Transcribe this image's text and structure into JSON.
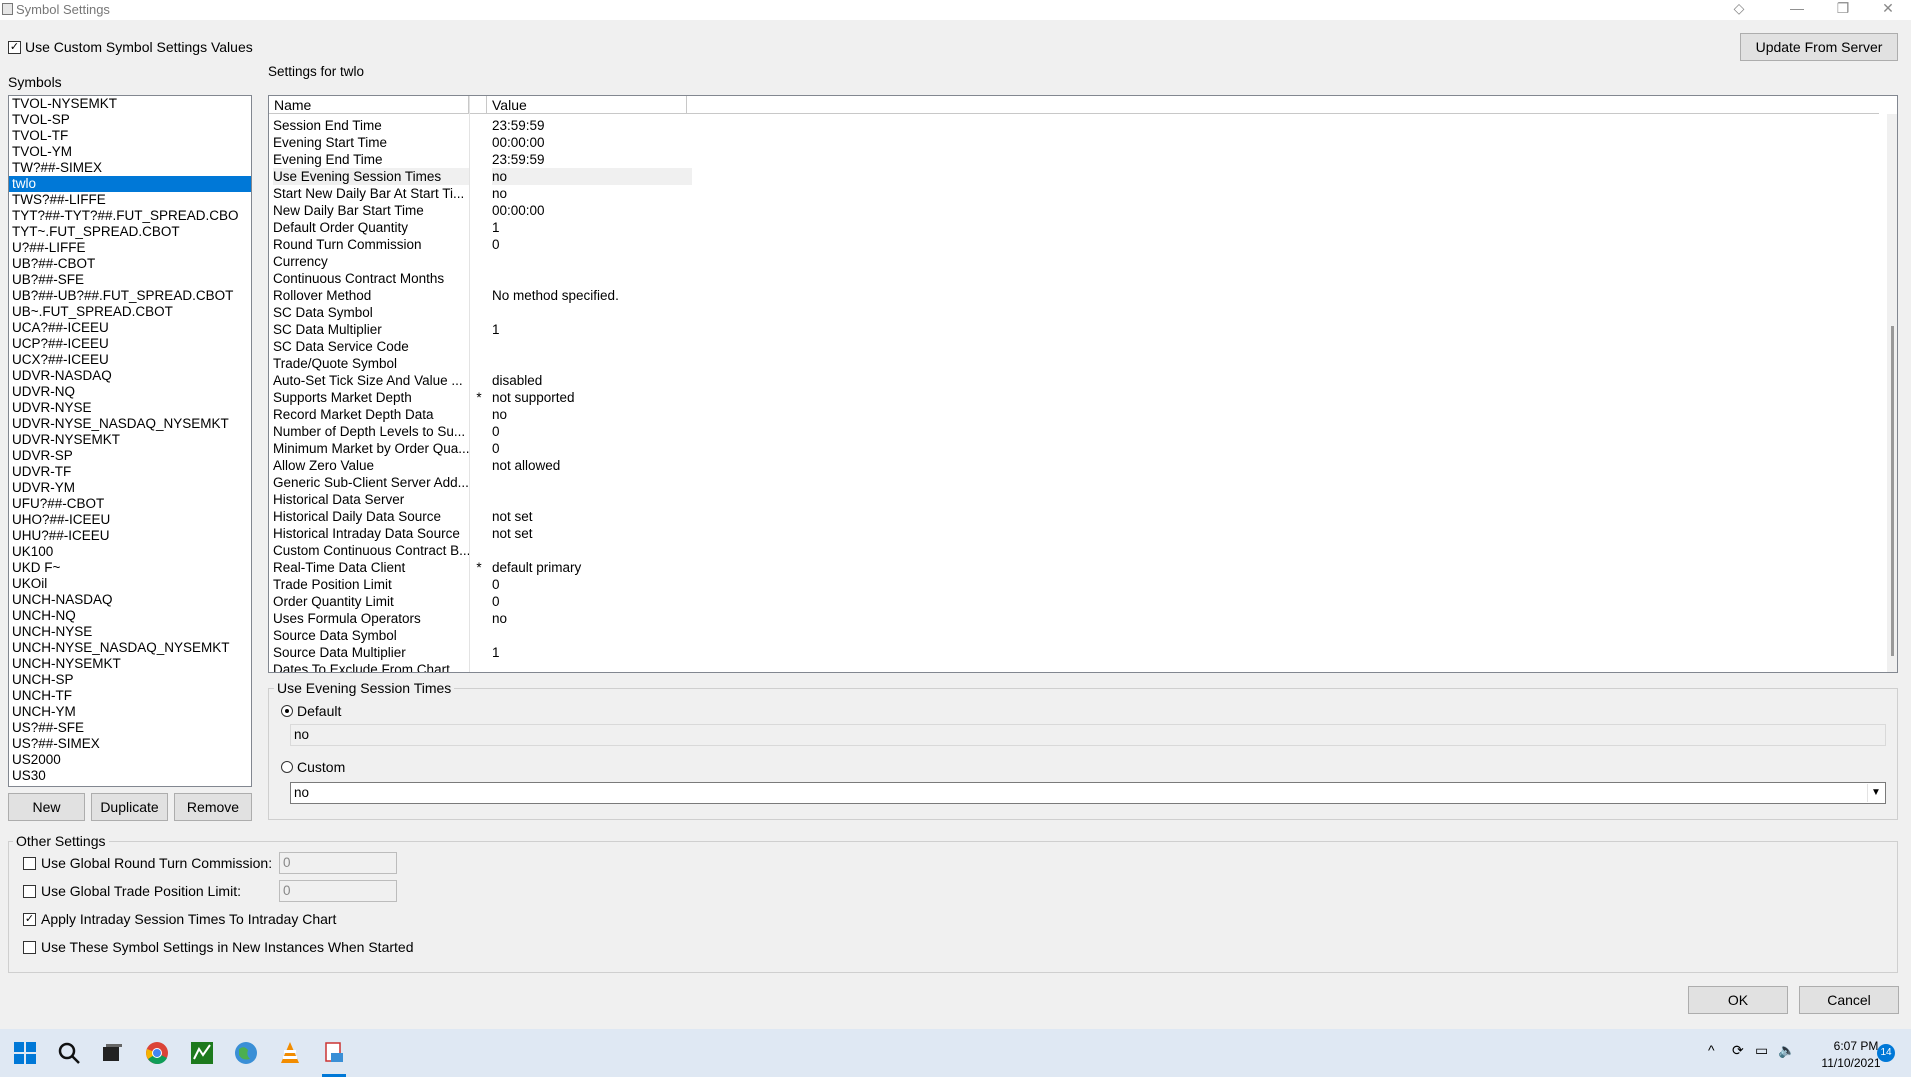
{
  "window": {
    "title": "Symbol Settings"
  },
  "top": {
    "use_custom_label": "Use Custom Symbol Settings Values",
    "update_button": "Update From Server"
  },
  "symbols": {
    "label": "Symbols",
    "items": [
      "TVOL-NYSEMKT",
      "TVOL-SP",
      "TVOL-TF",
      "TVOL-YM",
      "TW?##-SIMEX",
      "twlo",
      "TWS?##-LIFFE",
      "TYT?##-TYT?##.FUT_SPREAD.CBO",
      "TYT~.FUT_SPREAD.CBOT",
      "U?##-LIFFE",
      "UB?##-CBOT",
      "UB?##-SFE",
      "UB?##-UB?##.FUT_SPREAD.CBOT",
      "UB~.FUT_SPREAD.CBOT",
      "UCA?##-ICEEU",
      "UCP?##-ICEEU",
      "UCX?##-ICEEU",
      "UDVR-NASDAQ",
      "UDVR-NQ",
      "UDVR-NYSE",
      "UDVR-NYSE_NASDAQ_NYSEMKT",
      "UDVR-NYSEMKT",
      "UDVR-SP",
      "UDVR-TF",
      "UDVR-YM",
      "UFU?##-CBOT",
      "UHO?##-ICEEU",
      "UHU?##-ICEEU",
      "UK100",
      "UKD F~",
      "UKOil",
      "UNCH-NASDAQ",
      "UNCH-NQ",
      "UNCH-NYSE",
      "UNCH-NYSE_NASDAQ_NYSEMKT",
      "UNCH-NYSEMKT",
      "UNCH-SP",
      "UNCH-TF",
      "UNCH-YM",
      "US?##-SFE",
      "US?##-SIMEX",
      "US2000",
      "US30"
    ],
    "selected": "twlo",
    "new_button": "New",
    "duplicate_button": "Duplicate",
    "remove_button": "Remove"
  },
  "settings": {
    "title": "Settings for twlo",
    "col_name": "Name",
    "col_value": "Value",
    "rows": [
      {
        "name": "Session End Time",
        "star": "",
        "value": "23:59:59"
      },
      {
        "name": "Evening Start Time",
        "star": "",
        "value": "00:00:00"
      },
      {
        "name": "Evening End Time",
        "star": "",
        "value": "23:59:59"
      },
      {
        "name": "Use Evening Session Times",
        "star": "",
        "value": "no",
        "selected": true
      },
      {
        "name": "Start New Daily Bar At Start Ti...",
        "star": "",
        "value": "no"
      },
      {
        "name": "New Daily Bar Start Time",
        "star": "",
        "value": "00:00:00"
      },
      {
        "name": "Default Order Quantity",
        "star": "",
        "value": "1"
      },
      {
        "name": "Round Turn Commission",
        "star": "",
        "value": "0"
      },
      {
        "name": "Currency",
        "star": "",
        "value": ""
      },
      {
        "name": "Continuous Contract Months",
        "star": "",
        "value": ""
      },
      {
        "name": "Rollover Method",
        "star": "",
        "value": "No method specified."
      },
      {
        "name": "SC Data Symbol",
        "star": "",
        "value": ""
      },
      {
        "name": "SC Data Multiplier",
        "star": "",
        "value": "1"
      },
      {
        "name": "SC Data Service Code",
        "star": "",
        "value": ""
      },
      {
        "name": "Trade/Quote Symbol",
        "star": "",
        "value": ""
      },
      {
        "name": "Auto-Set Tick Size And Value ...",
        "star": "",
        "value": "disabled"
      },
      {
        "name": "Supports Market Depth",
        "star": "*",
        "value": "not supported"
      },
      {
        "name": "Record Market Depth Data",
        "star": "",
        "value": "no"
      },
      {
        "name": "Number of Depth Levels to Su...",
        "star": "",
        "value": "0"
      },
      {
        "name": "Minimum Market by Order Qua...",
        "star": "",
        "value": "0"
      },
      {
        "name": "Allow Zero Value",
        "star": "",
        "value": "not allowed"
      },
      {
        "name": "Generic Sub-Client Server Add...",
        "star": "",
        "value": ""
      },
      {
        "name": "Historical Data Server",
        "star": "",
        "value": ""
      },
      {
        "name": "Historical Daily Data Source",
        "star": "",
        "value": "not set"
      },
      {
        "name": "Historical Intraday Data Source",
        "star": "",
        "value": "not set"
      },
      {
        "name": "Custom Continuous Contract B...",
        "star": "",
        "value": ""
      },
      {
        "name": "Real-Time Data Client",
        "star": "*",
        "value": "default primary"
      },
      {
        "name": "Trade Position Limit",
        "star": "",
        "value": "0"
      },
      {
        "name": "Order Quantity Limit",
        "star": "",
        "value": "0"
      },
      {
        "name": "Uses Formula Operators",
        "star": "",
        "value": "no"
      },
      {
        "name": "Source Data Symbol",
        "star": "",
        "value": ""
      },
      {
        "name": "Source Data Multiplier",
        "star": "",
        "value": "1"
      },
      {
        "name": "Dates To Exclude From Chart",
        "star": "",
        "value": ""
      }
    ]
  },
  "evening": {
    "group_title": "Use Evening Session Times",
    "default_label": "Default",
    "default_value": "no",
    "custom_label": "Custom",
    "custom_value": "no"
  },
  "other": {
    "group_title": "Other Settings",
    "global_commission_label": "Use Global Round Turn Commission:",
    "global_commission_value": "0",
    "global_position_label": "Use Global Trade Position Limit:",
    "global_position_value": "0",
    "apply_intraday_label": "Apply Intraday Session Times To Intraday Chart",
    "use_new_instances_label": "Use These Symbol Settings in New Instances When Started"
  },
  "buttons": {
    "ok": "OK",
    "cancel": "Cancel"
  },
  "taskbar": {
    "time": "6:07 PM",
    "date": "11/10/2021",
    "notifications": "14"
  }
}
